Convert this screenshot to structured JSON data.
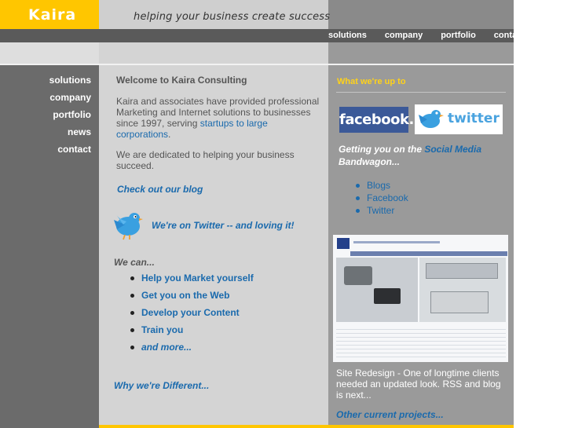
{
  "brand": {
    "name": "Kaira",
    "tagline": "helping your business create success"
  },
  "top_nav": {
    "items": [
      "solutions",
      "company",
      "portfolio",
      "contact"
    ]
  },
  "side_nav": {
    "items": [
      "solutions",
      "company",
      "portfolio",
      "news",
      "contact"
    ]
  },
  "main": {
    "welcome_title": "Welcome to Kaira Consulting",
    "intro_text": "Kaira and associates have provided professional  Marketing and Internet solutions to businesses since 1997, serving ",
    "intro_link": "startups to large corporations",
    "intro_end": ".",
    "dedicated_text": "We are dedicated to helping your business succeed.",
    "blog_link": "Check out our blog",
    "twitter_message": "We're on Twitter -- and loving it!",
    "we_can_heading": "We can...",
    "we_can_items": [
      "Help you Market yourself",
      "Get you on the Web",
      "Develop your Content",
      "Train you",
      "and more..."
    ],
    "why_link": "Why we're Different..."
  },
  "right": {
    "heading": "What we're up to",
    "facebook_logo": "facebook.",
    "twitter_logo": "twitter",
    "social_prefix": "Getting you on the ",
    "social_link": "Social Media",
    "social_suffix": " Bandwagon...",
    "social_items": [
      "Blogs",
      "Facebook",
      "Twitter"
    ],
    "redesign_text": "Site Redesign - One of longtime clients needed an updated look. RSS and blog is next...",
    "other_link": "Other current projects..."
  },
  "colors": {
    "accent": "#ffc600",
    "link": "#1a6aad",
    "sidebar": "#6b6b6b",
    "main_bg": "#d4d4d4",
    "right_bg": "#9a9a9a"
  },
  "icons": {
    "bird": "twitter-bird-icon",
    "bullet": "bullet-dot-icon"
  }
}
